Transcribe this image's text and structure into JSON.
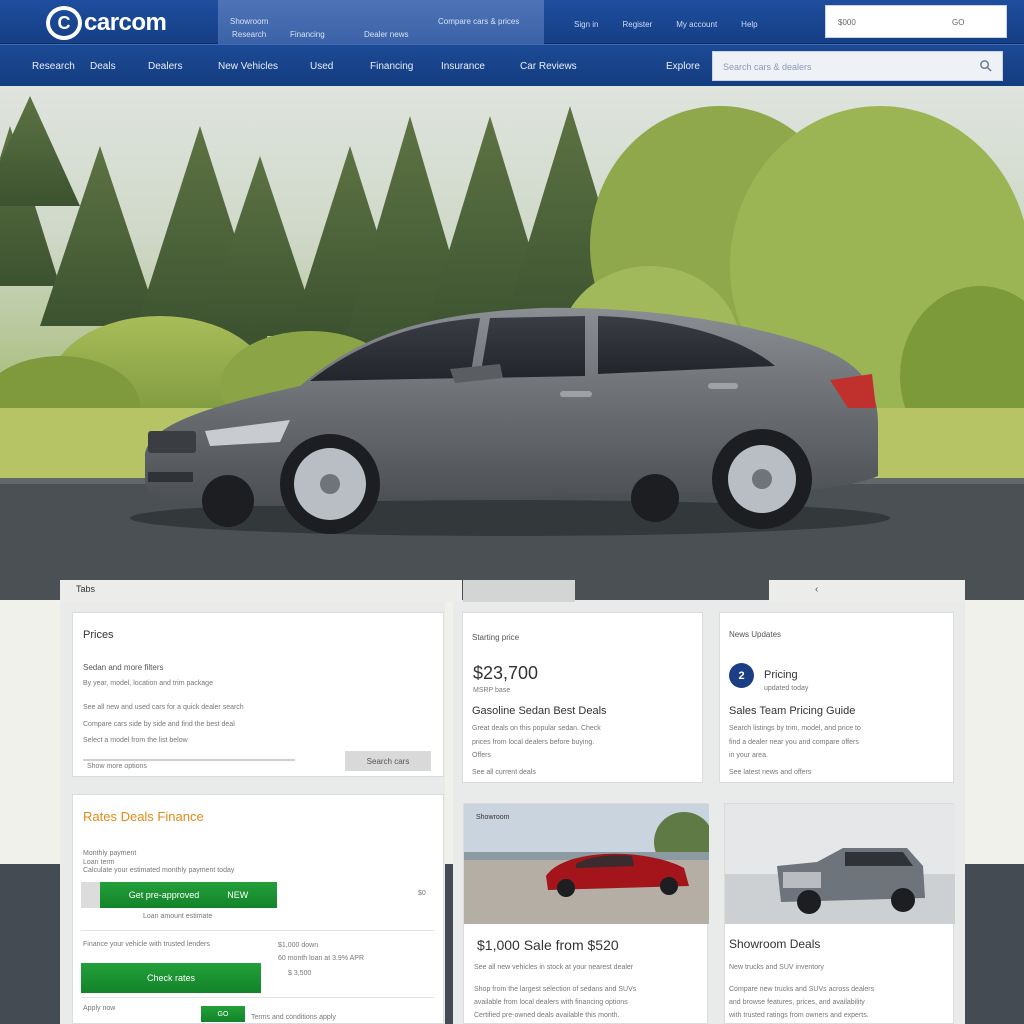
{
  "header": {
    "logo_mark": "C",
    "logo_text": "carcom",
    "panel_links": [
      "Showroom",
      "Research",
      "Financing",
      "Dealer news",
      "Compare cars & prices"
    ],
    "top_links": [
      "Sign in",
      "Register",
      "My account",
      "Help"
    ],
    "search_value": "$000",
    "search_button": "GO"
  },
  "nav": {
    "items": [
      "Research",
      "Deals",
      "Dealers",
      "New Vehicles",
      "Used",
      "Financing",
      "Insurance",
      "Car Reviews",
      "Explore"
    ],
    "search_placeholder": "Search cars & dealers"
  },
  "tabs": {
    "label": "Tabs",
    "arrow": "‹"
  },
  "filter_card": {
    "title": "Prices",
    "line1": "Sedan  and more filters",
    "line2": "By year, model, location and trim package",
    "line3": "See all new and used cars for a quick dealer search",
    "line4": "Compare cars side by side and find the best deal",
    "line5": "Select a model from the list below",
    "link": "Show more options",
    "button": "Search cars"
  },
  "price_card": {
    "label": "Starting price",
    "price": "$23,700",
    "sub": "MSRP base",
    "headline": "Gasoline Sedan  Best Deals",
    "body1": "Great deals on this popular sedan. Check",
    "body2": "prices from local dealers before buying.",
    "body3": "Offers",
    "link": "See all current deals"
  },
  "news_card": {
    "label": "News Updates",
    "badge": "2",
    "badge_title": "Pricing",
    "badge_sub": "updated today",
    "headline": "Sales Team Pricing Guide",
    "body1": "Search listings by trim, model, and price to",
    "body2": "find a dealer near you and compare offers",
    "body3": "in your area.",
    "link": "See latest news and offers"
  },
  "offer_card": {
    "title": "Rates  Deals  Finance",
    "line1": "Monthly payment",
    "line2": "Loan term",
    "line3": "Calculate your estimated monthly payment today",
    "button1": "Get pre-approved",
    "button1_tag": "NEW",
    "side_val": "$0",
    "line4": "Loan amount estimate",
    "line5": "Finance your vehicle with trusted lenders",
    "button2": "Check rates",
    "right1": "$1,000 down",
    "right2": "60 month loan at 3.9% APR",
    "right3": "$ 3,500",
    "foot1": "Apply now",
    "foot2": "GO",
    "foot3": "Terms and conditions apply"
  },
  "thumb1_card": {
    "caption": "Showroom",
    "headline": "$1,000 Sale  from $520",
    "sub": "See all new vehicles in stock at your nearest dealer",
    "body1": "Shop from the largest selection of sedans and SUVs",
    "body2": "available from local dealers with financing options",
    "body3": "Certified pre-owned deals available this month."
  },
  "thumb2_card": {
    "headline": "Showroom Deals",
    "sub": "New trucks and SUV inventory",
    "body1": "Compare new trucks and SUVs across dealers",
    "body2": "and browse features, prices, and availability",
    "body3": "with trusted ratings from owners and experts."
  },
  "colors": {
    "header_blue": "#1f4e9e",
    "accent_green": "#1a9634",
    "accent_orange": "#e28a17",
    "badge_navy": "#1c3e84"
  }
}
